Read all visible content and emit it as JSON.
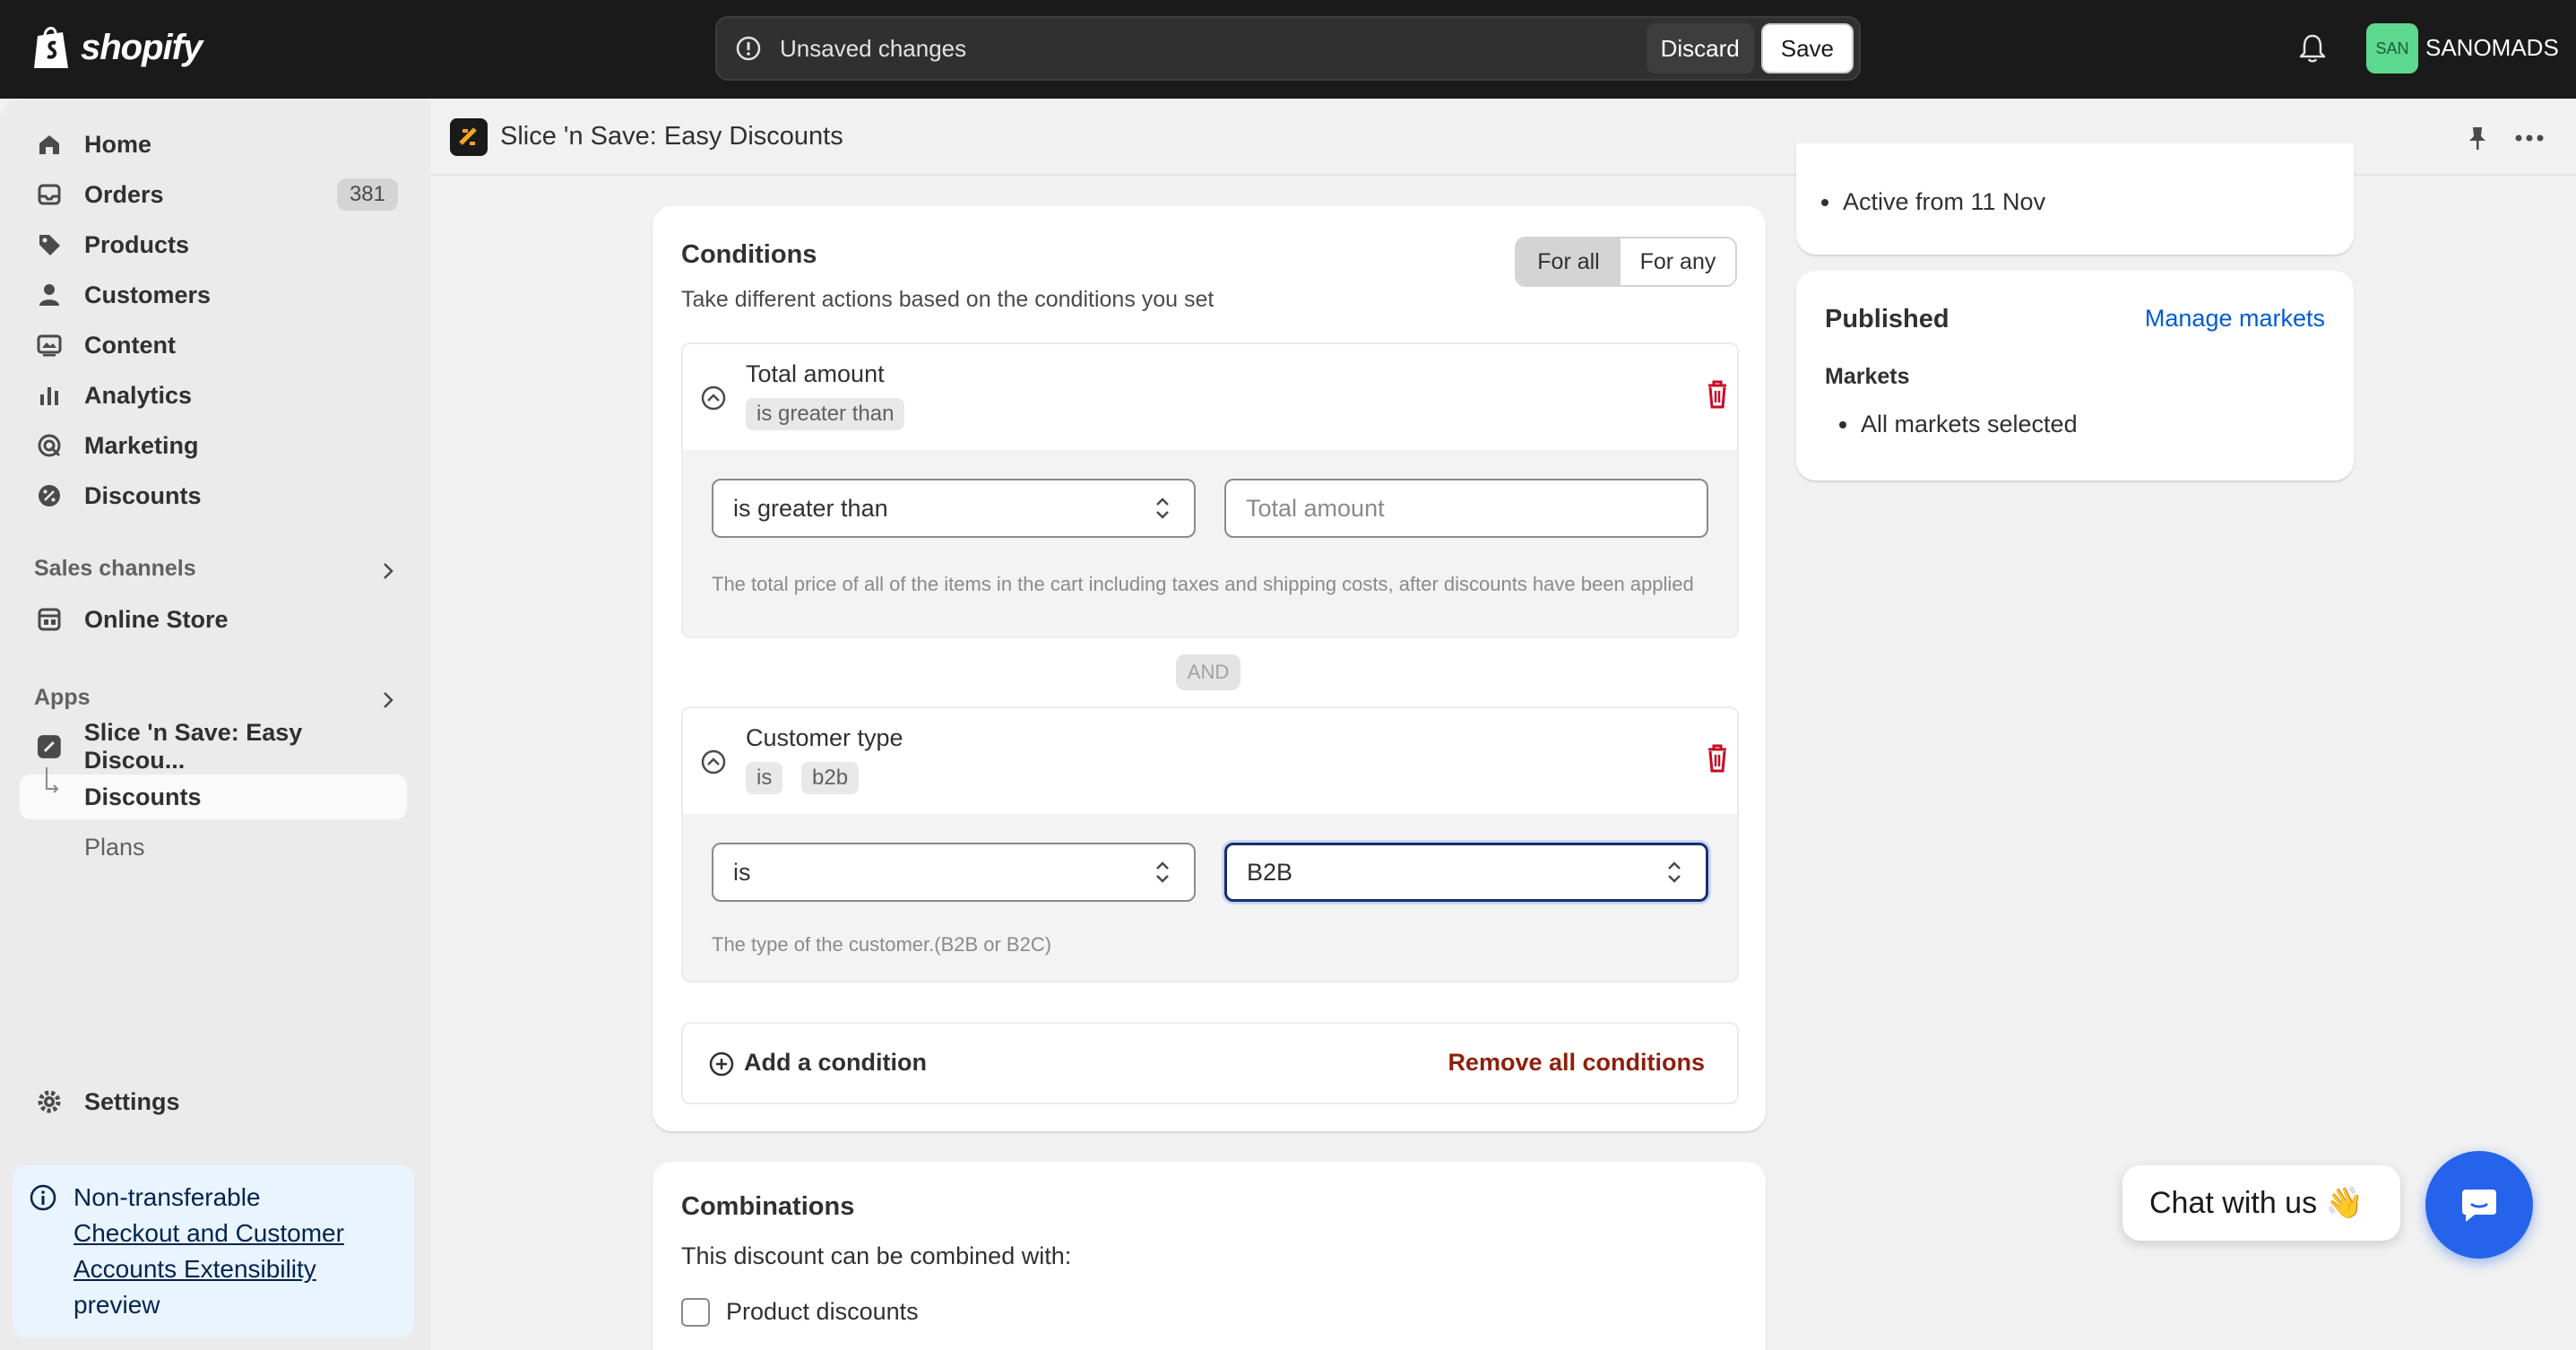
{
  "topbar": {
    "brand": "shopify",
    "unsaved_text": "Unsaved changes",
    "discard_label": "Discard",
    "save_label": "Save",
    "store_initials": "SAN",
    "store_name": "SANOMADS"
  },
  "sidebar": {
    "items": [
      {
        "label": "Home",
        "icon": "home-icon"
      },
      {
        "label": "Orders",
        "icon": "orders-icon",
        "badge": "381"
      },
      {
        "label": "Products",
        "icon": "tag-icon"
      },
      {
        "label": "Customers",
        "icon": "person-icon"
      },
      {
        "label": "Content",
        "icon": "content-icon"
      },
      {
        "label": "Analytics",
        "icon": "analytics-icon"
      },
      {
        "label": "Marketing",
        "icon": "marketing-icon"
      },
      {
        "label": "Discounts",
        "icon": "discount-icon"
      }
    ],
    "sales_channels_title": "Sales channels",
    "online_store": "Online Store",
    "apps_title": "Apps",
    "app_name": "Slice 'n Save: Easy Discou...",
    "app_sub_discounts": "Discounts",
    "app_sub_plans": "Plans",
    "settings": "Settings",
    "info": {
      "line1": "Non-transferable",
      "link": "Checkout and Customer Accounts Extensibility",
      "line3": "preview"
    }
  },
  "app_header": {
    "title": "Slice 'n Save: Easy Discounts"
  },
  "conditions": {
    "title": "Conditions",
    "subtitle": "Take different actions based on the conditions you set",
    "toggle_all": "For all",
    "toggle_any": "For any",
    "and_label": "AND",
    "items": [
      {
        "name": "Total amount",
        "chips": [
          "is greater than"
        ],
        "operator": "is greater than",
        "value_placeholder": "Total amount",
        "help": "The total price of all of the items in the cart including taxes and shipping costs, after discounts have been applied"
      },
      {
        "name": "Customer type",
        "chips": [
          "is",
          "b2b"
        ],
        "operator": "is",
        "value": "B2B",
        "help": "The type of the customer.(B2B or B2C)"
      }
    ],
    "add_label": "Add a condition",
    "remove_label": "Remove all conditions"
  },
  "combinations": {
    "title": "Combinations",
    "subtitle": "This discount can be combined with:",
    "option": "Product discounts"
  },
  "right": {
    "active_text": "Active from 11 Nov",
    "published_title": "Published",
    "manage_markets": "Manage markets",
    "markets_label": "Markets",
    "markets_value": "All markets selected"
  },
  "chat": {
    "label": "Chat with us 👋"
  },
  "colors": {
    "accent": "#005bd3",
    "critical": "#8e1f0b",
    "chat": "#2563eb"
  }
}
